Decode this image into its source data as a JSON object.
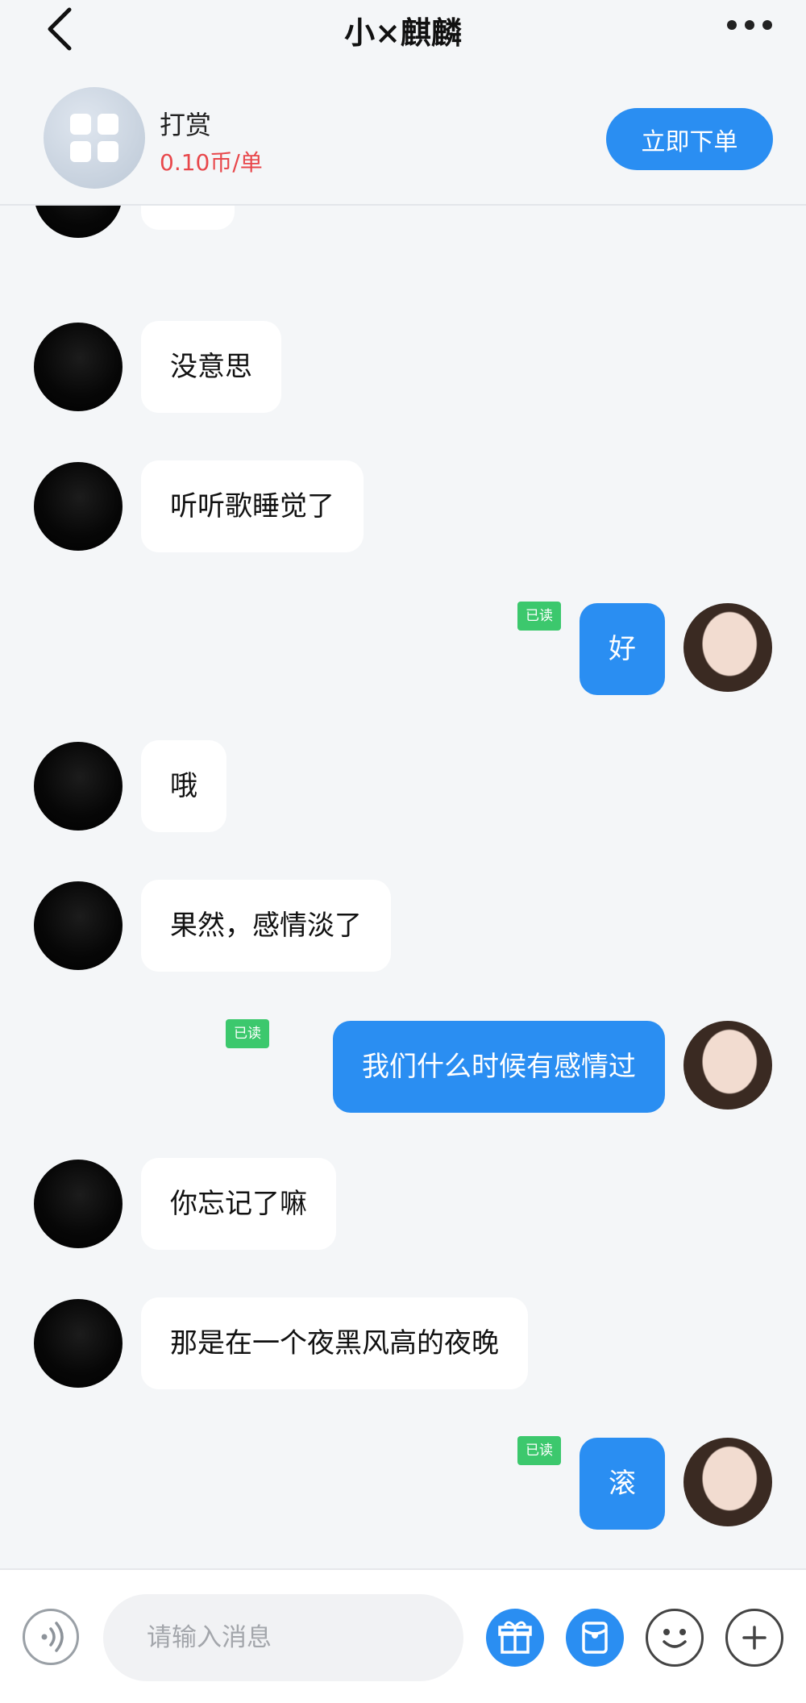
{
  "header": {
    "title": "小×麒麟"
  },
  "order": {
    "name": "打赏",
    "price": "0.10币/单",
    "button_label": "立即下单"
  },
  "messages": [
    {
      "side": "left",
      "text": ""
    },
    {
      "side": "left",
      "text": "没意思"
    },
    {
      "side": "left",
      "text": "听听歌睡觉了"
    },
    {
      "side": "right",
      "text": "好",
      "status": "已读"
    },
    {
      "side": "left",
      "text": "哦"
    },
    {
      "side": "left",
      "text": "果然，感情淡了"
    },
    {
      "side": "right",
      "text": "我们什么时候有感情过",
      "status": "已读"
    },
    {
      "side": "left",
      "text": "你忘记了嘛"
    },
    {
      "side": "left",
      "text": "那是在一个夜黑风高的夜晚"
    },
    {
      "side": "right",
      "text": "滚",
      "status": "已读"
    }
  ],
  "composer": {
    "placeholder": "请输入消息"
  },
  "icons": {
    "first_message_emoji": "sleeping-face-emoji"
  },
  "colors": {
    "accent": "#2a8ef2",
    "price": "#e8474b",
    "read_badge": "#3cc86d",
    "background": "#f4f6f8"
  }
}
